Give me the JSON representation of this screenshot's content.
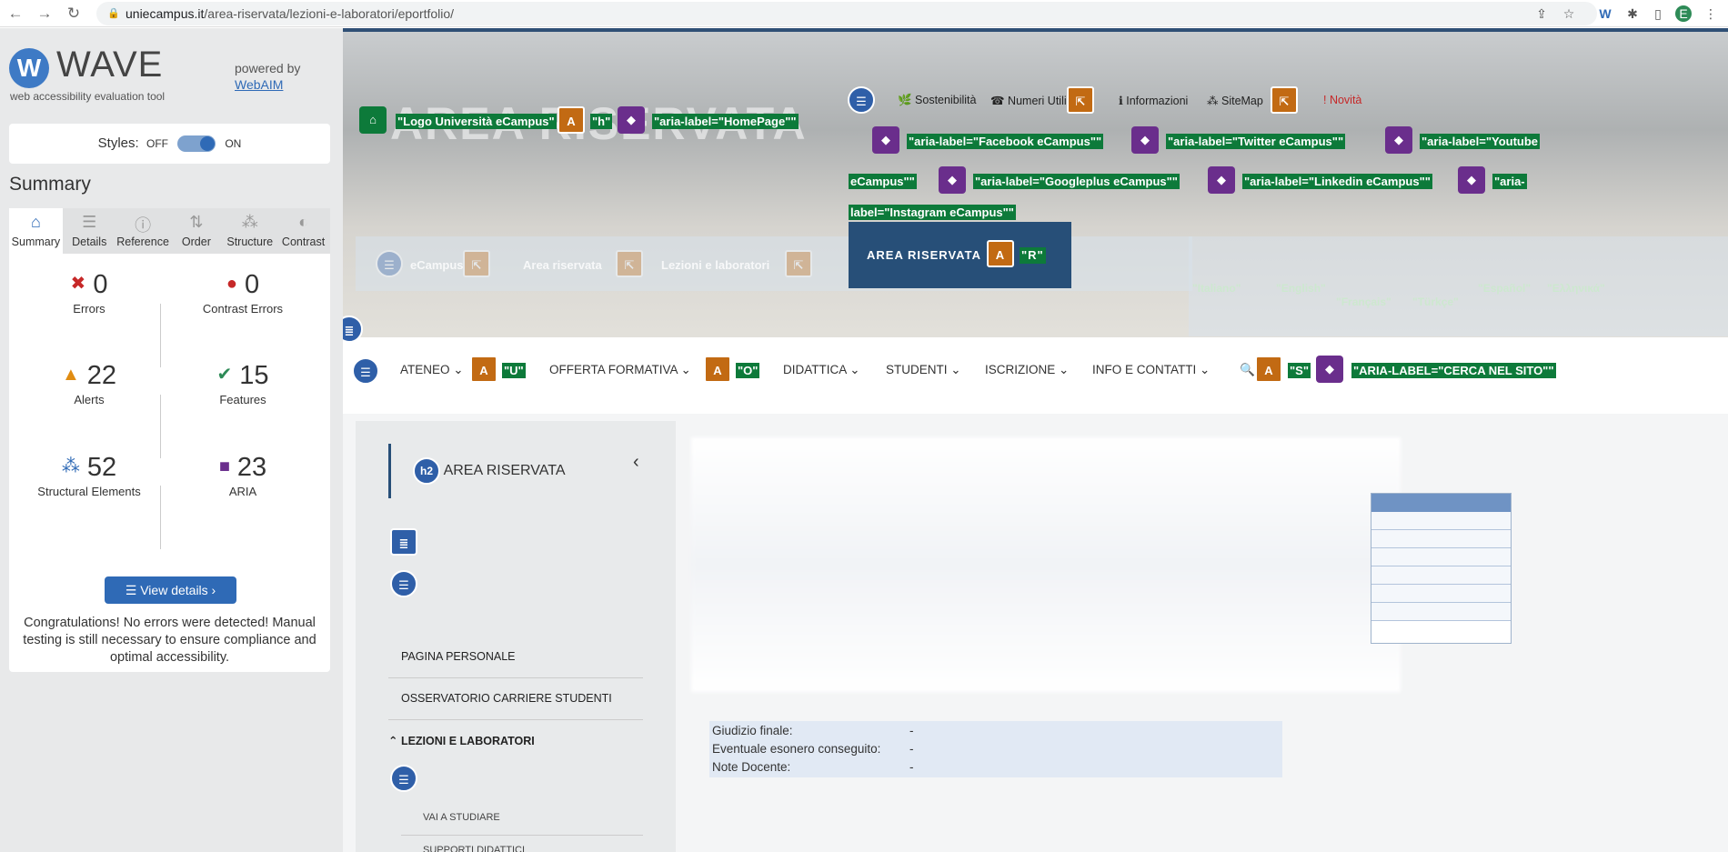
{
  "browser": {
    "url_domain": "uniecampus.it",
    "url_path": "/area-riservata/lezioni-e-laboratori/eportfolio/"
  },
  "wave": {
    "logo_letter": "W",
    "title": "WAVE",
    "subtitle": "web accessibility evaluation tool",
    "powered_by": "powered by",
    "webaim": "WebAIM",
    "styles_label": "Styles:",
    "styles_off": "OFF",
    "styles_on": "ON",
    "summary_heading": "Summary",
    "tabs": [
      {
        "label": "Summary"
      },
      {
        "label": "Details"
      },
      {
        "label": "Reference"
      },
      {
        "label": "Order"
      },
      {
        "label": "Structure"
      },
      {
        "label": "Contrast"
      }
    ],
    "stats": {
      "errors": {
        "n": "0",
        "label": "Errors"
      },
      "contrast": {
        "n": "0",
        "label": "Contrast Errors"
      },
      "alerts": {
        "n": "22",
        "label": "Alerts"
      },
      "features": {
        "n": "15",
        "label": "Features"
      },
      "structural": {
        "n": "52",
        "label": "Structural Elements"
      },
      "aria": {
        "n": "23",
        "label": "ARIA"
      }
    },
    "view_details": "View details ›",
    "congrats": "Congratulations! No errors were detected! Manual testing is still necessary to ensure compliance and optimal accessibility."
  },
  "site": {
    "hero_title": "AREA RISERVATA",
    "hero_prefix": "S",
    "labels": {
      "logo": "\"Logo Università eCampus\"",
      "h": "\"h\"",
      "homepage": "\"aria-label=\"HomePage\"\"",
      "facebook": "\"aria-label=\"Facebook eCampus\"\"",
      "twitter": "\"aria-label=\"Twitter eCampus\"\"",
      "youtube1": "\"aria-label=\"Youtube",
      "youtube2": "eCampus\"\"",
      "googleplus": "\"aria-label=\"Googleplus eCampus\"\"",
      "linkedin": "\"aria-label=\"Linkedin eCampus\"\"",
      "instagram1": "\"aria-",
      "instagram2": "label=\"Instagram eCampus\"\"",
      "r": "\"R\"",
      "u": "\"U\"",
      "o": "\"O\"",
      "s": "\"S\"",
      "cerca": "\"ARIA-LABEL=\"CERCA NEL SITO\"\""
    },
    "toplinks": {
      "sost": "Sostenibilità",
      "num": "Numeri Utili",
      "info": "Informazioni",
      "sitemap": "SiteMap",
      "novita": "Novità"
    },
    "crumbs": [
      "eCampus",
      "Area riservata",
      "Lezioni e laboratori"
    ],
    "area_button": "AREA RISERVATA",
    "langs": [
      "\"Italiano\"",
      "\"English\"",
      "\"Français\"",
      "\"Türkçe\"",
      "\"Español\"",
      "\"Ελληνικά\""
    ],
    "nav": [
      "ATENEO",
      "OFFERTA FORMATIVA",
      "DIDATTICA",
      "STUDENTI",
      "ISCRIZIONE",
      "INFO E CONTATTI"
    ],
    "sidebar": {
      "h2": "h2",
      "title": "AREA RISERVATA",
      "items": [
        "PAGINA PERSONALE",
        "OSSERVATORIO CARRIERE STUDENTI",
        "LEZIONI E LABORATORI"
      ],
      "subitems": [
        "VAI A STUDIARE",
        "SUPPORTI DIDATTICI"
      ]
    },
    "giudizio": [
      {
        "label": "Giudizio finale:",
        "value": "-"
      },
      {
        "label": "Eventuale esonero conseguito:",
        "value": "-"
      },
      {
        "label": "Note Docente:",
        "value": "-"
      }
    ]
  }
}
